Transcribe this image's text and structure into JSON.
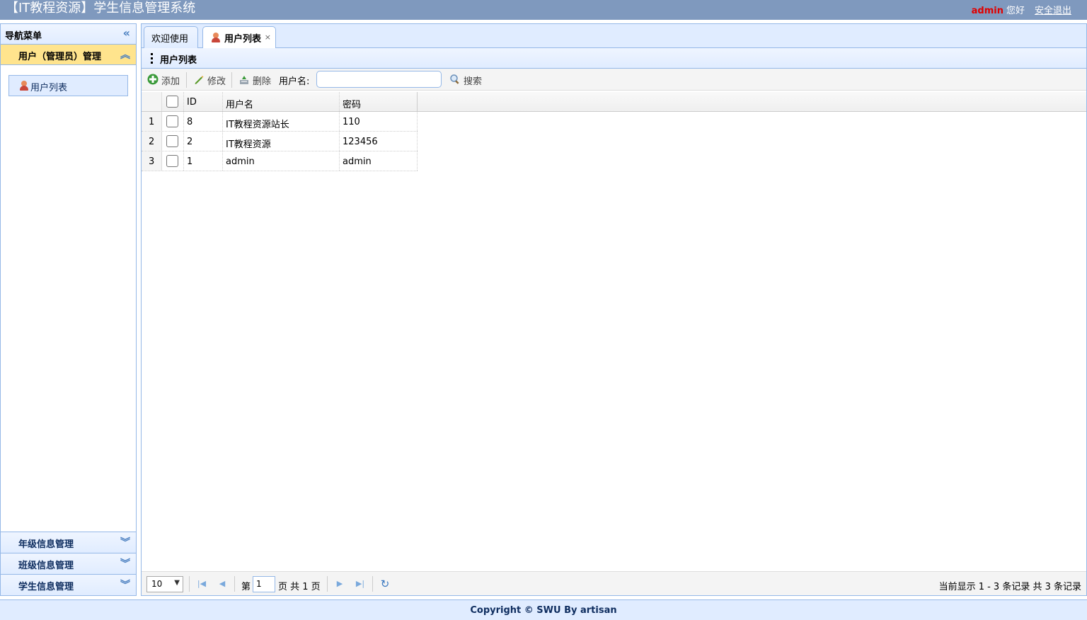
{
  "header": {
    "title": "【IT教程资源】学生信息管理系统",
    "username": "admin",
    "greeting": "您好",
    "logout": "安全退出"
  },
  "nav": {
    "title": "导航菜单",
    "active_section": "用户（管理员）管理",
    "active_items": [
      {
        "label": "用户列表",
        "icon": "user-icon"
      }
    ],
    "sections": [
      "年级信息管理",
      "班级信息管理",
      "学生信息管理"
    ]
  },
  "tabs": [
    {
      "label": "欢迎使用"
    },
    {
      "label": "用户列表",
      "icon": "user-icon",
      "close": "×"
    }
  ],
  "panel": {
    "title": "用户列表"
  },
  "toolbar": {
    "add": "添加",
    "edit": "修改",
    "delete": "删除",
    "username_label": "用户名:",
    "username_value": "",
    "search": "搜索"
  },
  "table": {
    "columns": [
      "ID",
      "用户名",
      "密码"
    ],
    "rows": [
      {
        "no": "1",
        "id": "8",
        "name": "IT教程资源站长",
        "pwd": "110"
      },
      {
        "no": "2",
        "id": "2",
        "name": "IT教程资源",
        "pwd": "123456"
      },
      {
        "no": "3",
        "id": "1",
        "name": "admin",
        "pwd": "admin"
      }
    ]
  },
  "pager": {
    "page_size": "10",
    "page_prefix": "第",
    "page_value": "1",
    "page_suffix": "页 共 1 页",
    "info": "当前显示 1 - 3 条记录 共 3 条记录"
  },
  "footer": {
    "text": "Copyright © SWU By artisan"
  },
  "colors": {
    "accent": "#95b8e7",
    "header_bg": "#7f99be",
    "active_section": "#ffe48d",
    "username": "#e00000"
  }
}
